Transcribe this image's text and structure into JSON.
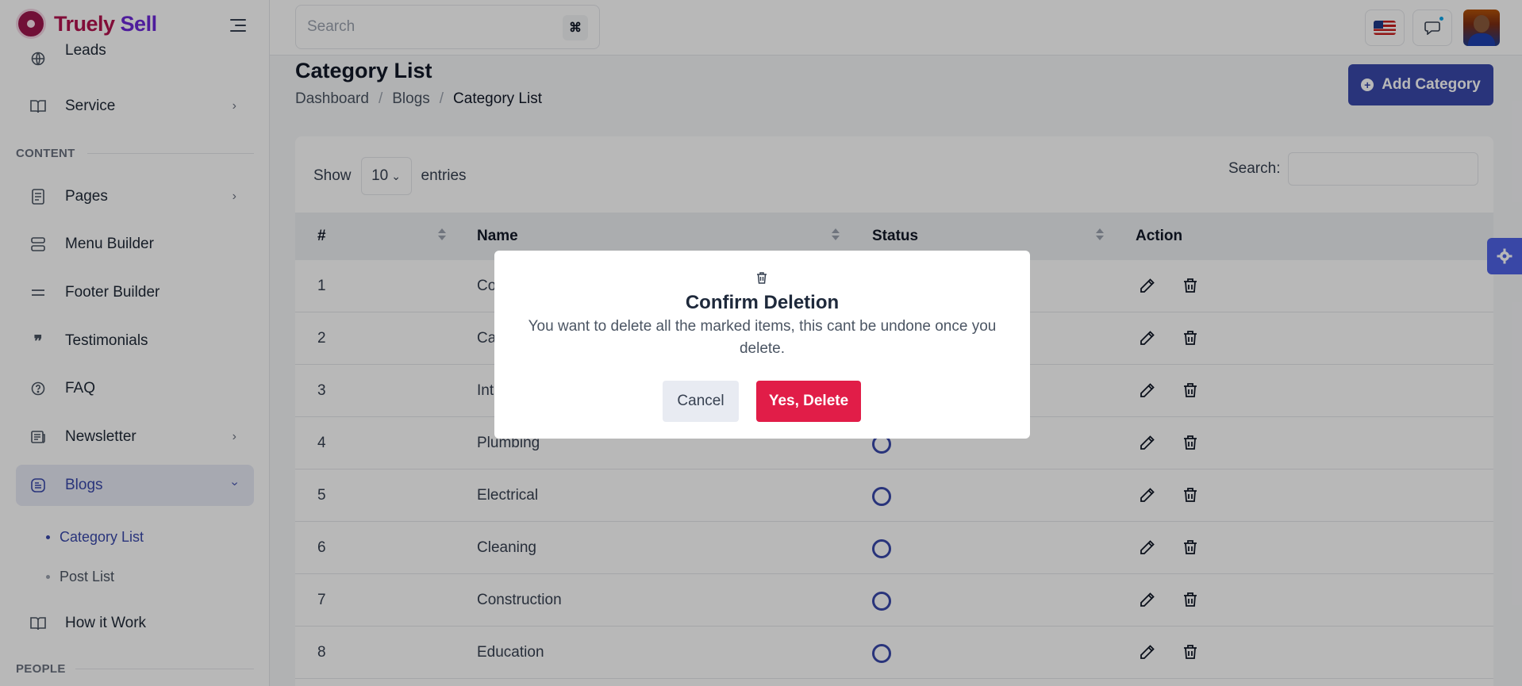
{
  "brand": {
    "name_part1": "Truely ",
    "name_part2": "Sell"
  },
  "topbar": {
    "search_placeholder": "Search",
    "shortcut_symbol": "⌘"
  },
  "sidebar": {
    "items": [
      {
        "label": "Leads",
        "icon": "globe-icon"
      },
      {
        "label": "Service",
        "icon": "book-icon"
      },
      {
        "label": "Pages",
        "icon": "document-icon"
      },
      {
        "label": "Menu Builder",
        "icon": "layers-icon"
      },
      {
        "label": "Footer Builder",
        "icon": "minus-lines-icon"
      },
      {
        "label": "Testimonials",
        "icon": "quote-icon"
      },
      {
        "label": "FAQ",
        "icon": "help-circle-icon"
      },
      {
        "label": "Newsletter",
        "icon": "newspaper-icon"
      },
      {
        "label": "Blogs",
        "icon": "blog-icon"
      },
      {
        "label": "How it Work",
        "icon": "book-icon"
      }
    ],
    "sections": {
      "content": "CONTENT",
      "people": "PEOPLE"
    },
    "blog_sub": [
      "Category List",
      "Post List"
    ]
  },
  "page": {
    "title": "Category List",
    "breadcrumb": [
      "Dashboard",
      "Blogs",
      "Category List"
    ],
    "breadcrumb_sep": "/",
    "add_button": "Add Category"
  },
  "table": {
    "show_label": "Show",
    "entries_value": "10",
    "entries_label": "entries",
    "search_label": "Search:",
    "headers": [
      "#",
      "Name",
      "Status",
      "Action"
    ],
    "rows": [
      {
        "num": "1",
        "name": "Co"
      },
      {
        "num": "2",
        "name": "Ca"
      },
      {
        "num": "3",
        "name": "Int"
      },
      {
        "num": "4",
        "name": "Plumbing"
      },
      {
        "num": "5",
        "name": "Electrical"
      },
      {
        "num": "6",
        "name": "Cleaning"
      },
      {
        "num": "7",
        "name": "Construction"
      },
      {
        "num": "8",
        "name": "Education"
      }
    ]
  },
  "modal": {
    "title": "Confirm Deletion",
    "message": "You want to delete all the marked items, this cant be undone once you delete.",
    "cancel": "Cancel",
    "confirm": "Yes, Delete"
  },
  "colors": {
    "accent": "#3949ab",
    "danger": "#e11d48",
    "brand": "#b3124e"
  }
}
